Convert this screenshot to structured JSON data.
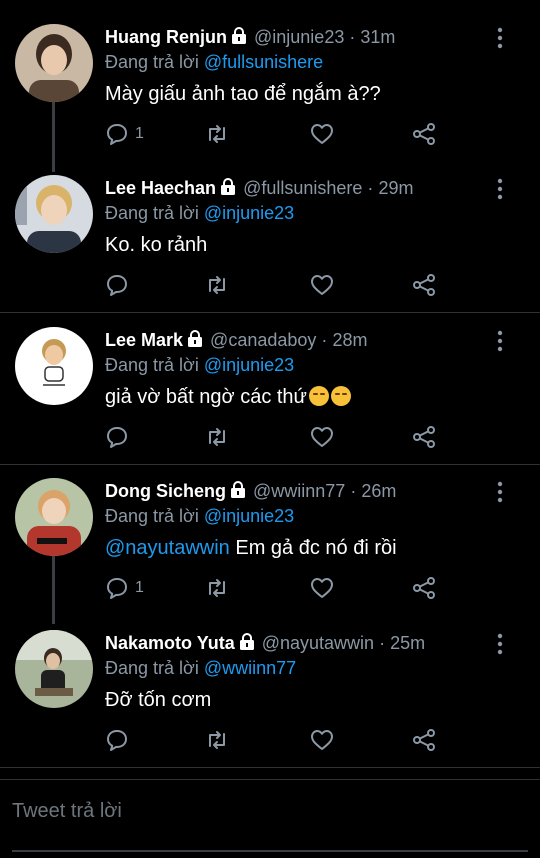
{
  "tweets": [
    {
      "name": "Huang Renjun",
      "handle": "@injunie23",
      "dot": "·",
      "time": "31m",
      "reply_prefix": "Đang trả lời ",
      "reply_to": "@fullsunishere",
      "text": "Mày giấu ảnh tao để ngắm à??",
      "reply_count": "1",
      "avatar_color": "#5a4636"
    },
    {
      "name": "Lee Haechan",
      "handle": "@fullsunishere",
      "dot": "·",
      "time": "29m",
      "reply_prefix": "Đang trả lời ",
      "reply_to": "@injunie23",
      "text": "Ko. ko rảnh",
      "reply_count": "",
      "avatar_color": "#b9c1cc"
    },
    {
      "name": "Lee Mark",
      "handle": "@canadaboy",
      "dot": "·",
      "time": "28m",
      "reply_prefix": "Đang trả lời ",
      "reply_to": "@injunie23",
      "text": "giả vờ bất ngờ các thứ",
      "reply_count": "",
      "avatar_color": "#ffffff"
    },
    {
      "name": "Dong Sicheng",
      "handle": "@wwiinn77",
      "dot": "·",
      "time": "26m",
      "reply_prefix": "Đang trả lời ",
      "reply_to": "@injunie23",
      "text_mention": "@nayutawwin",
      "text": " Em gả đc nó đi rồi",
      "reply_count": "1",
      "avatar_color": "#a23a2e"
    },
    {
      "name": "Nakamoto Yuta",
      "handle": "@nayutawwin",
      "dot": "·",
      "time": "25m",
      "reply_prefix": "Đang trả lời ",
      "reply_to": "@wwiinn77",
      "text": "Đỡ tốn cơm",
      "reply_count": "",
      "avatar_color": "#6f7d5a"
    }
  ],
  "compose": {
    "placeholder": "Tweet trả lời"
  },
  "colors": {
    "background": "#000000",
    "link": "#1d9bf0",
    "muted": "#8b98a5"
  }
}
